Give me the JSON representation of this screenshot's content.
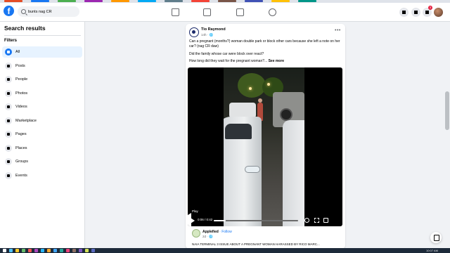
{
  "browser": {
    "bookmark_colors": [
      "#e44d26",
      "#1877f2",
      "#4caf50",
      "#9c27b0",
      "#ff9800",
      "#03a9f4",
      "#607d8b",
      "#f44336",
      "#795548",
      "#3f51b5",
      "#ffc107",
      "#009688"
    ]
  },
  "topnav": {
    "logo": "f",
    "search_value": "bunts nag CR",
    "notification_count": "3",
    "icons": [
      "home-icon",
      "watch-icon",
      "marketplace-icon",
      "groups-icon",
      "menu-grid-icon",
      "messenger-icon",
      "bell-icon"
    ]
  },
  "sidebar": {
    "title": "Search results",
    "filters_label": "Filters",
    "items": [
      {
        "label": "All",
        "icon": "all-icon"
      },
      {
        "label": "Posts",
        "icon": "posts-icon"
      },
      {
        "label": "People",
        "icon": "people-icon"
      },
      {
        "label": "Photos",
        "icon": "photos-icon"
      },
      {
        "label": "Videos",
        "icon": "videos-icon"
      },
      {
        "label": "Marketplace",
        "icon": "marketplace-icon"
      },
      {
        "label": "Pages",
        "icon": "pages-icon"
      },
      {
        "label": "Places",
        "icon": "places-icon"
      },
      {
        "label": "Groups",
        "icon": "groups-icon"
      },
      {
        "label": "Events",
        "icon": "events-icon"
      }
    ],
    "active_item": "All"
  },
  "post": {
    "author": "Tio Raymond",
    "time": "14h · 🌐",
    "more": "•••",
    "line1": "Can a pregnant (months?) woman double park or block other cars because she left a note on her car? (nag CR daw)",
    "line2": "Did the family whose car were block over react?",
    "line3": "How long did they wait for the pregnant woman?...",
    "see_more": "See more",
    "video": {
      "play_label": "Play",
      "time": "0:06 / 0:42",
      "progress": 0.14
    },
    "shared": {
      "author": "Applefied",
      "follow": "· Follow",
      "time": "2d · 🌐",
      "text": "NAIA TERMINAL 3 ISSUE ABOUT A PREGNANT WOMAN HARASSED BY RICO MARC..."
    }
  },
  "taskbar": {
    "clock": "10:07 AM"
  }
}
